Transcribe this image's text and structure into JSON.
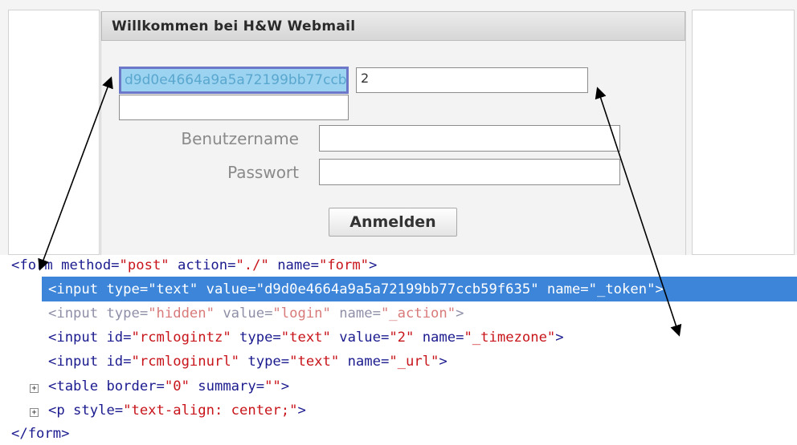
{
  "login": {
    "title": "Willkommen bei H&W Webmail",
    "token_value": "d9d0e4664a9a5a72199bb77ccb59f635",
    "timezone_value": "2",
    "url_value": "",
    "username_label": "Benutzername",
    "password_label": "Passwort",
    "username_value": "",
    "password_value": "",
    "submit_label": "Anmelden"
  },
  "inspector": {
    "form_open": {
      "tag_open": "<form",
      "method_attr": " method=",
      "method_val": "\"post\"",
      "action_attr": " action=",
      "action_val": "\"./\"",
      "name_attr": " name=",
      "name_val": "\"form\"",
      "close": ">"
    },
    "token_input": {
      "tag_open": "<input",
      "type_attr": " type=",
      "type_val": "\"text\"",
      "value_attr": " value=",
      "value_val": "\"d9d0e4664a9a5a72199bb77ccb59f635\"",
      "name_attr": " name=",
      "name_val": "\"_token\"",
      "close": ">"
    },
    "action_input": {
      "tag_open": "<input",
      "type_attr": " type=",
      "type_val": "\"hidden\"",
      "value_attr": " value=",
      "value_val": "\"login\"",
      "name_attr": " name=",
      "name_val": "\"_action\"",
      "close": ">"
    },
    "tz_input": {
      "tag_open": "<input",
      "id_attr": " id=",
      "id_val": "\"rcmlogintz\"",
      "type_attr": " type=",
      "type_val": "\"text\"",
      "value_attr": " value=",
      "value_val": "\"2\"",
      "name_attr": " name=",
      "name_val": "\"_timezone\"",
      "close": ">"
    },
    "url_input": {
      "tag_open": "<input",
      "id_attr": " id=",
      "id_val": "\"rcmloginurl\"",
      "type_attr": " type=",
      "type_val": "\"text\"",
      "name_attr": " name=",
      "name_val": "\"_url\"",
      "close": ">"
    },
    "table_node": {
      "tag_open": "<table",
      "border_attr": " border=",
      "border_val": "\"0\"",
      "summary_attr": " summary=",
      "summary_val": "\"\"",
      "close": ">"
    },
    "p_node": {
      "tag_open": "<p",
      "style_attr": " style=",
      "style_val": "\"text-align: center;\"",
      "close": ">"
    },
    "form_close": "</form>",
    "expand_glyph": "+"
  },
  "colors": {
    "selection": "#3d85d8",
    "tag": "#1b1b8f",
    "value": "#c8151b",
    "token_field_bg": "#9cd3f0"
  }
}
